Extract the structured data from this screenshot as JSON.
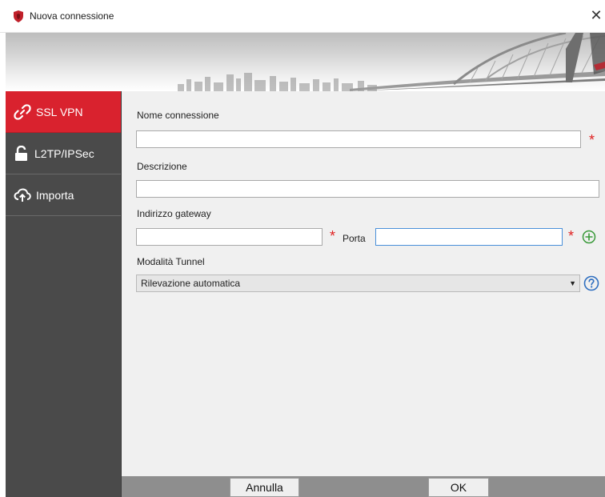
{
  "window": {
    "title": "Nuova connessione",
    "close_glyph": "✕"
  },
  "sidebar": {
    "items": [
      {
        "label": "SSL VPN",
        "icon": "link-icon",
        "active": true
      },
      {
        "label": "L2TP/IPSec",
        "icon": "unlock-icon",
        "active": false
      },
      {
        "label": "Importa",
        "icon": "cloud-upload-icon",
        "active": false
      }
    ]
  },
  "form": {
    "connection_name": {
      "label": "Nome connessione",
      "value": ""
    },
    "description": {
      "label": "Descrizione",
      "value": ""
    },
    "gateway": {
      "label": "Indirizzo gateway",
      "value": ""
    },
    "port": {
      "label": "Porta",
      "value": ""
    },
    "tunnel_mode": {
      "label": "Modalità Tunnel",
      "selected": "Rilevazione automatica"
    },
    "required_mark": "*"
  },
  "footer": {
    "cancel_label": "Annulla",
    "ok_label": "OK"
  },
  "colors": {
    "accent": "#d9222e",
    "sidebar_bg": "#4a4a4a",
    "content_bg": "#f0f0f0",
    "add_icon": "#3a9a3a",
    "help_icon": "#2f6fc0"
  }
}
